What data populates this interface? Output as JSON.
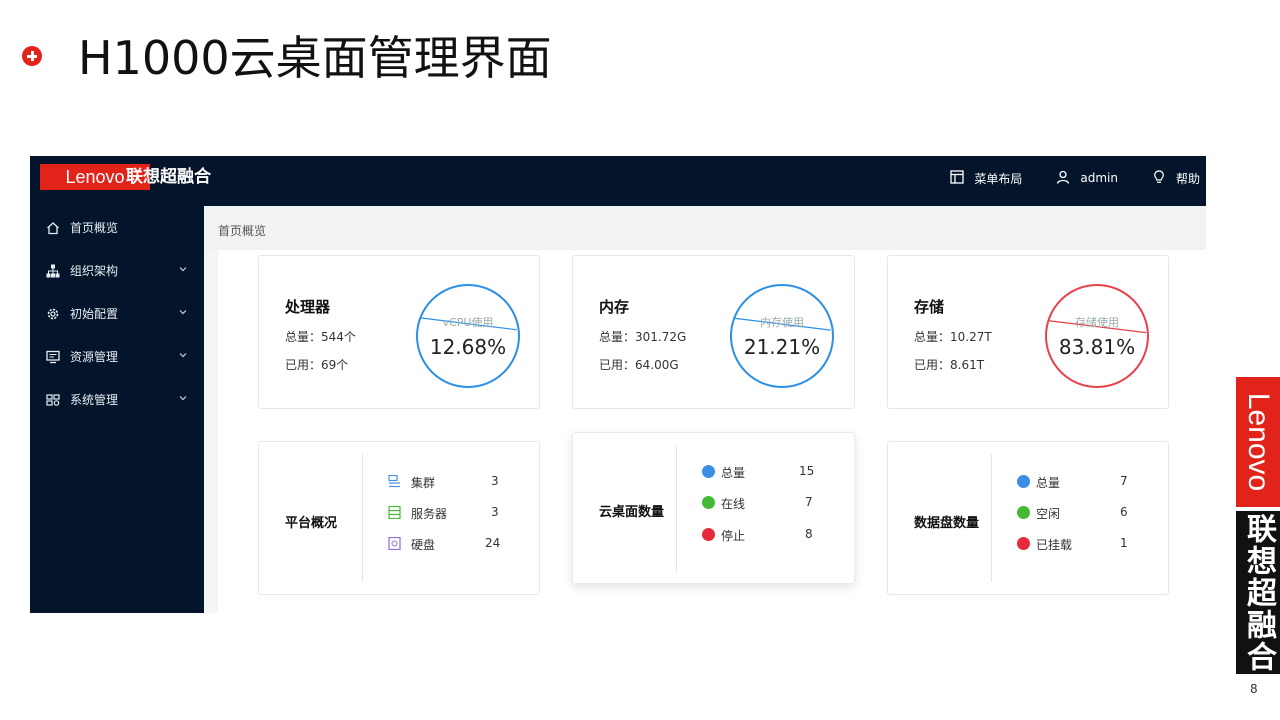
{
  "slide": {
    "title": "H1000云桌面管理界面",
    "page_number": "8"
  },
  "app": {
    "logo_text": "Lenovo",
    "brand": "联想超融合",
    "top_actions": [
      {
        "label": "菜单布局",
        "icon": "layout-icon"
      },
      {
        "label": "admin",
        "icon": "user-icon"
      },
      {
        "label": "帮助",
        "icon": "lightbulb-icon"
      }
    ],
    "sidebar": [
      {
        "label": "首页概览",
        "icon": "home-icon",
        "has_chevron": false
      },
      {
        "label": "组织架构",
        "icon": "org-icon",
        "has_chevron": true
      },
      {
        "label": "初始配置",
        "icon": "gear-icon",
        "has_chevron": true
      },
      {
        "label": "资源管理",
        "icon": "monitor-icon",
        "has_chevron": true
      },
      {
        "label": "系统管理",
        "icon": "system-icon",
        "has_chevron": true
      }
    ],
    "breadcrumb": "首页概览",
    "resource_cards": [
      {
        "title": "处理器",
        "total": "总量：544个",
        "used": "已用：69个",
        "gauge_caption": "vCPU使用",
        "gauge_value": "12.68%",
        "percent": 12.68,
        "color": "#2b8fe6"
      },
      {
        "title": "内存",
        "total": "总量：301.72G",
        "used": "已用：64.00G",
        "gauge_caption": "内存使用",
        "gauge_value": "21.21%",
        "percent": 21.21,
        "color": "#2b8fe6"
      },
      {
        "title": "存储",
        "total": "总量：10.27T",
        "used": "已用：8.61T",
        "gauge_caption": "存储使用",
        "gauge_value": "83.81%",
        "percent": 83.81,
        "color": "#e8414b"
      }
    ],
    "platform": {
      "label": "平台概况",
      "rows": [
        {
          "label": "集群",
          "value": "3",
          "icon": "cluster-icon"
        },
        {
          "label": "服务器",
          "value": "3",
          "icon": "server-icon"
        },
        {
          "label": "硬盘",
          "value": "24",
          "icon": "disk-icon"
        }
      ]
    },
    "desktops": {
      "label": "云桌面数量",
      "rows": [
        {
          "label": "总量",
          "value": "15",
          "color": "#3a8ee6"
        },
        {
          "label": "在线",
          "value": "7",
          "color": "#44b935"
        },
        {
          "label": "停止",
          "value": "8",
          "color": "#e8293a"
        }
      ]
    },
    "data_disks": {
      "label": "数据盘数量",
      "rows": [
        {
          "label": "总量",
          "value": "7",
          "color": "#3a8ee6"
        },
        {
          "label": "空闲",
          "value": "6",
          "color": "#44b935"
        },
        {
          "label": "已挂载",
          "value": "1",
          "color": "#e8293a"
        }
      ]
    }
  },
  "side_brand": {
    "logo_text": "Lenovo",
    "brand": "联想超融合"
  }
}
